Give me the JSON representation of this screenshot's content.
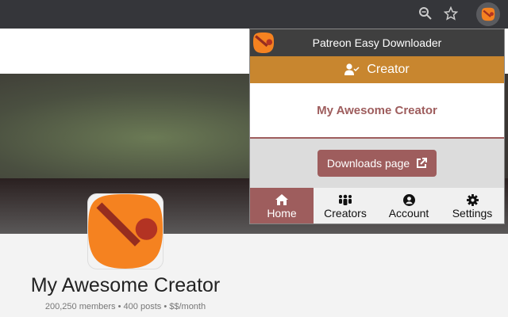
{
  "browser": {
    "icons": [
      "zoom-icon",
      "star-icon",
      "extension-icon"
    ]
  },
  "page": {
    "creator_name": "My Awesome Creator",
    "members": "200,250 members",
    "posts": "400 posts",
    "price": "$$/month",
    "separator": "•"
  },
  "popup": {
    "title": "Patreon Easy Downloader",
    "section": "Creator",
    "creator_name": "My Awesome Creator",
    "downloads_button": "Downloads page",
    "nav": [
      {
        "label": "Home",
        "icon": "home-icon",
        "active": true
      },
      {
        "label": "Creators",
        "icon": "users-icon"
      },
      {
        "label": "Account",
        "icon": "account-icon"
      },
      {
        "label": "Settings",
        "icon": "gear-icon"
      }
    ]
  },
  "colors": {
    "accent": "#9e5d5d",
    "header": "#c8862f",
    "logo": "#f58220"
  }
}
